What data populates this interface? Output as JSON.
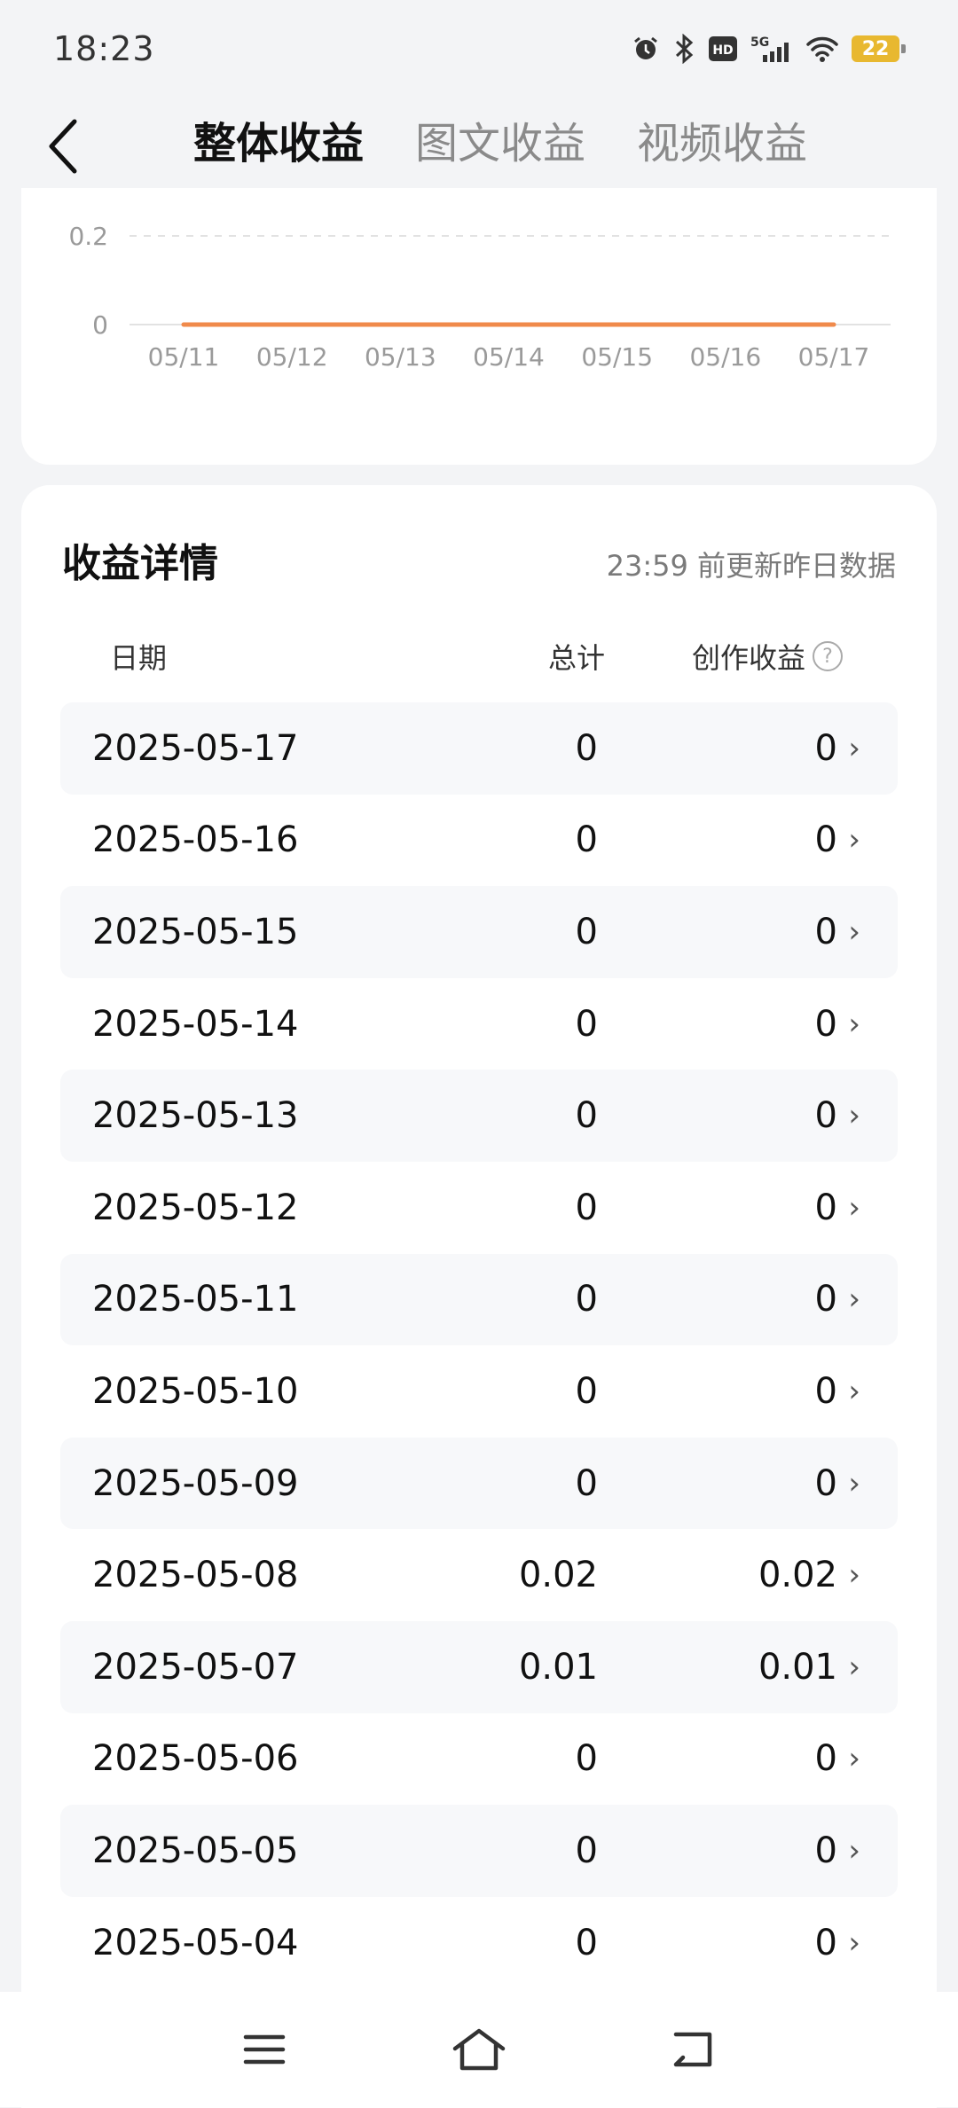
{
  "status": {
    "time": "18:23",
    "battery": "22",
    "network": "5G"
  },
  "header": {
    "tabs": [
      {
        "label": "整体收益",
        "active": true
      },
      {
        "label": "图文收益",
        "active": false
      },
      {
        "label": "视频收益",
        "active": false
      }
    ]
  },
  "chart_data": {
    "type": "line",
    "x": [
      "05/11",
      "05/12",
      "05/13",
      "05/14",
      "05/15",
      "05/16",
      "05/17"
    ],
    "series": [
      {
        "values": [
          0,
          0,
          0,
          0,
          0,
          0,
          0
        ],
        "color": "#f08a4b"
      }
    ],
    "ytick_labels": [
      "0",
      "0.2"
    ],
    "ylim": [
      0,
      0.2
    ],
    "grid": true
  },
  "detail": {
    "title": "收益详情",
    "note": "23:59 前更新昨日数据",
    "columns": {
      "date": "日期",
      "total": "总计",
      "earnings": "创作收益"
    },
    "rows": [
      {
        "date": "2025-05-17",
        "total": "0",
        "earnings": "0"
      },
      {
        "date": "2025-05-16",
        "total": "0",
        "earnings": "0"
      },
      {
        "date": "2025-05-15",
        "total": "0",
        "earnings": "0"
      },
      {
        "date": "2025-05-14",
        "total": "0",
        "earnings": "0"
      },
      {
        "date": "2025-05-13",
        "total": "0",
        "earnings": "0"
      },
      {
        "date": "2025-05-12",
        "total": "0",
        "earnings": "0"
      },
      {
        "date": "2025-05-11",
        "total": "0",
        "earnings": "0"
      },
      {
        "date": "2025-05-10",
        "total": "0",
        "earnings": "0"
      },
      {
        "date": "2025-05-09",
        "total": "0",
        "earnings": "0"
      },
      {
        "date": "2025-05-08",
        "total": "0.02",
        "earnings": "0.02"
      },
      {
        "date": "2025-05-07",
        "total": "0.01",
        "earnings": "0.01"
      },
      {
        "date": "2025-05-06",
        "total": "0",
        "earnings": "0"
      },
      {
        "date": "2025-05-05",
        "total": "0",
        "earnings": "0"
      },
      {
        "date": "2025-05-04",
        "total": "0",
        "earnings": "0"
      }
    ]
  }
}
